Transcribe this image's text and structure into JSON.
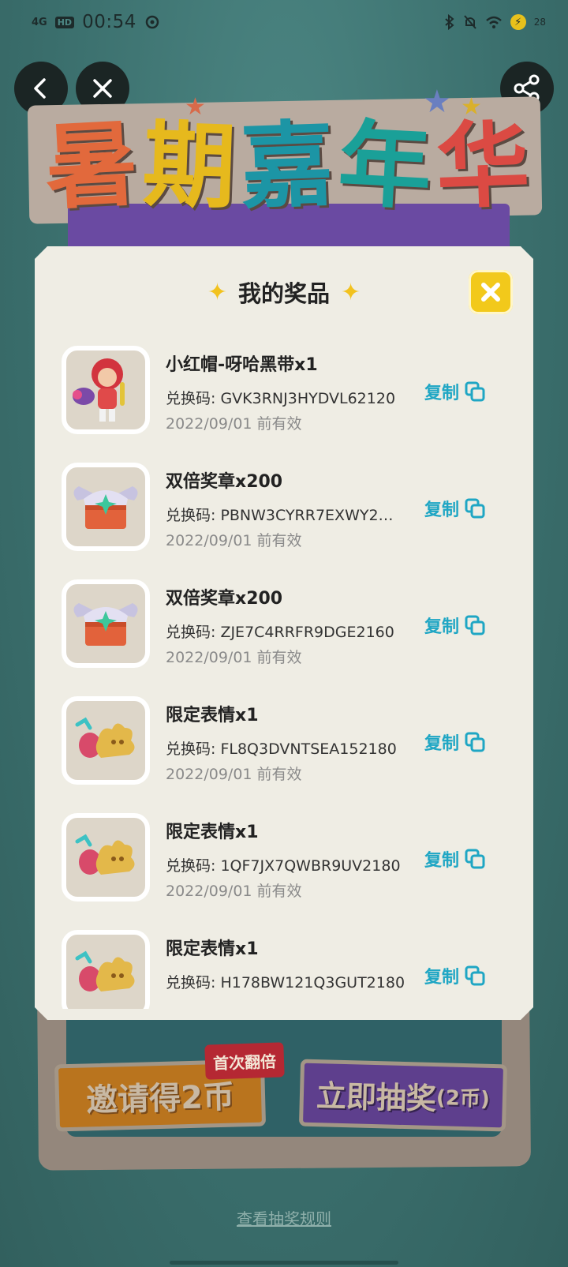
{
  "status_bar": {
    "network": "4G",
    "hd": "HD",
    "time": "00:54",
    "battery": "28"
  },
  "nav": {
    "back_icon": "chevron-left-icon",
    "close_icon": "close-icon",
    "share_icon": "share-icon"
  },
  "banner": {
    "chars": [
      "暑",
      "期",
      "嘉",
      "年",
      "华"
    ]
  },
  "modal": {
    "title": "我的奖品",
    "prizes": [
      {
        "name": "小红帽-呀哈黑带x1",
        "code": "兑换码: GVK3RNJ3HYDVL62120",
        "expiry": "2022/09/01 前有效",
        "copy": "复制",
        "icon": "character-avatar"
      },
      {
        "name": "双倍奖章x200",
        "code": "兑换码: PBNW3CYRR7EXWY2…",
        "expiry": "2022/09/01 前有效",
        "copy": "复制",
        "icon": "medal-chest"
      },
      {
        "name": "双倍奖章x200",
        "code": "兑换码: ZJE7C4RRFR9DGE2160",
        "expiry": "2022/09/01 前有效",
        "copy": "复制",
        "icon": "medal-chest"
      },
      {
        "name": "限定表情x1",
        "code": "兑换码: FL8Q3DVNTSEA152180",
        "expiry": "2022/09/01 前有效",
        "copy": "复制",
        "icon": "emote"
      },
      {
        "name": "限定表情x1",
        "code": "兑换码: 1QF7JX7QWBR9UV2180",
        "expiry": "2022/09/01 前有效",
        "copy": "复制",
        "icon": "emote"
      },
      {
        "name": "限定表情x1",
        "code": "兑换码: H178BW121Q3GUT2180",
        "expiry": "",
        "copy": "复制",
        "icon": "emote"
      }
    ]
  },
  "actions": {
    "invite": "邀请得2币",
    "first_double": "首次翻倍",
    "draw": "立即抽奖",
    "draw_cost": "(2币)",
    "rules": "查看抽奖规则"
  },
  "colors": {
    "background": "#3f7775",
    "modal": "#efede4",
    "accent_copy": "#1fa6c4",
    "close_yellow": "#f2c91b"
  }
}
